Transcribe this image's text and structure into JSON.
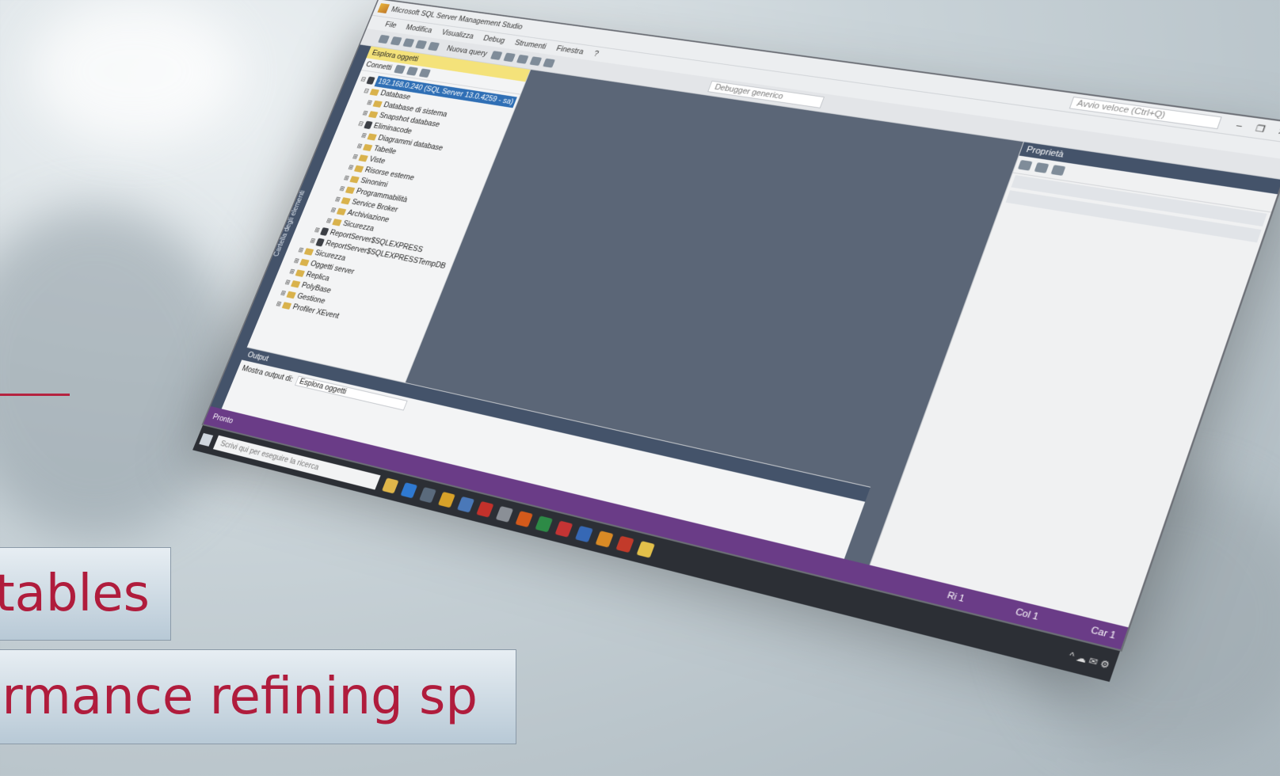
{
  "window": {
    "title": "Microsoft SQL Server Management Studio",
    "quick_launch": "Avvio veloce (Ctrl+Q)",
    "controls": [
      "–",
      "❐",
      "✕"
    ]
  },
  "menu": [
    "File",
    "Modifica",
    "Visualizza",
    "Debug",
    "Strumenti",
    "Finestra",
    "?"
  ],
  "toolbar": {
    "new_query": "Nuova query",
    "debugger": "Debugger generico"
  },
  "side_strip": "Cartella degli elementi",
  "explorer": {
    "title": "Esplora oggetti",
    "connect": "Connetti",
    "tree": [
      {
        "label": "192.168.0.240 (SQL Server 13.0.4259 - sa)",
        "level": 0,
        "type": "server",
        "expander": "⊟"
      },
      {
        "label": "Database",
        "level": 1,
        "type": "folder",
        "expander": "⊟"
      },
      {
        "label": "Database di sistema",
        "level": 2,
        "type": "folder",
        "expander": "⊞"
      },
      {
        "label": "Snapshot database",
        "level": 2,
        "type": "folder",
        "expander": "⊞"
      },
      {
        "label": "Eliminacode",
        "level": 2,
        "type": "db",
        "expander": "⊟"
      },
      {
        "label": "Diagrammi database",
        "level": 3,
        "type": "folder",
        "expander": "⊞"
      },
      {
        "label": "Tabelle",
        "level": 3,
        "type": "folder",
        "expander": "⊞"
      },
      {
        "label": "Viste",
        "level": 3,
        "type": "folder",
        "expander": "⊞"
      },
      {
        "label": "Risorse esterne",
        "level": 3,
        "type": "folder",
        "expander": "⊞"
      },
      {
        "label": "Sinonimi",
        "level": 3,
        "type": "folder",
        "expander": "⊞"
      },
      {
        "label": "Programmabilità",
        "level": 3,
        "type": "folder",
        "expander": "⊞"
      },
      {
        "label": "Service Broker",
        "level": 3,
        "type": "folder",
        "expander": "⊞"
      },
      {
        "label": "Archiviazione",
        "level": 3,
        "type": "folder",
        "expander": "⊞"
      },
      {
        "label": "Sicurezza",
        "level": 3,
        "type": "folder",
        "expander": "⊞"
      },
      {
        "label": "ReportServer$SQLEXPRESS",
        "level": 2,
        "type": "db",
        "expander": "⊞"
      },
      {
        "label": "ReportServer$SQLEXPRESSTempDB",
        "level": 2,
        "type": "db",
        "expander": "⊞"
      },
      {
        "label": "Sicurezza",
        "level": 1,
        "type": "folder",
        "expander": "⊞"
      },
      {
        "label": "Oggetti server",
        "level": 1,
        "type": "folder",
        "expander": "⊞"
      },
      {
        "label": "Replica",
        "level": 1,
        "type": "folder",
        "expander": "⊞"
      },
      {
        "label": "PolyBase",
        "level": 1,
        "type": "folder",
        "expander": "⊞"
      },
      {
        "label": "Gestione",
        "level": 1,
        "type": "folder",
        "expander": "⊞"
      },
      {
        "label": "Profiler XEvent",
        "level": 1,
        "type": "folder",
        "expander": "⊞"
      }
    ]
  },
  "properties": {
    "title": "Proprietà"
  },
  "output": {
    "title": "Output",
    "source_label": "Mostra output di:",
    "source_value": "Esplora oggetti"
  },
  "statusbar": {
    "state": "Pronto",
    "row": "Ri 1",
    "col": "Col 1",
    "car": "Car 1"
  },
  "taskbar": {
    "search_placeholder": "Scrivi qui per eseguire la ricerca"
  },
  "captions": {
    "line1": "tables",
    "line2": "rmance refining sp"
  },
  "colors": {
    "accent_red": "#b01c3c",
    "statusbar_purple": "#6a3c87",
    "explorer_header": "#f4e27a",
    "editor_bg": "#5b6677"
  }
}
